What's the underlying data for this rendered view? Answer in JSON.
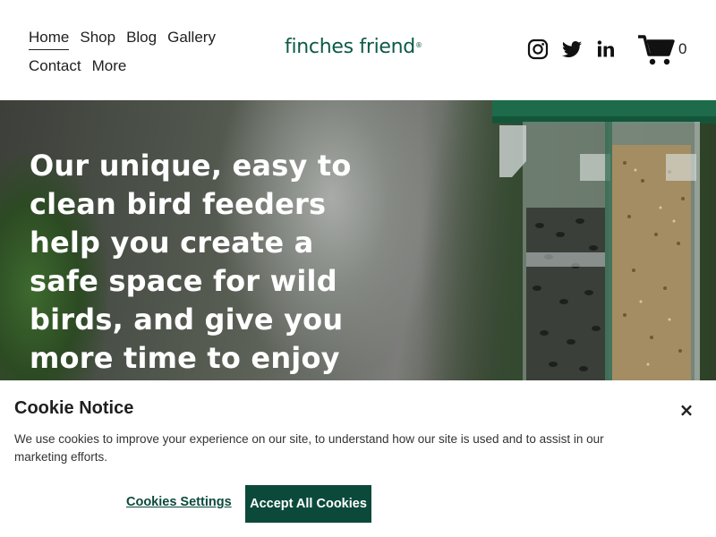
{
  "nav": {
    "items": [
      {
        "label": "Home",
        "active": true
      },
      {
        "label": "Shop"
      },
      {
        "label": "Blog"
      },
      {
        "label": "Gallery"
      },
      {
        "label": "Contact"
      },
      {
        "label": "More"
      }
    ]
  },
  "brand": {
    "name": "finches friend",
    "mark": "®",
    "color": "#0b5a46"
  },
  "header_icons": [
    "instagram-icon",
    "twitter-icon",
    "linkedin-icon",
    "cart-icon"
  ],
  "cart": {
    "count": "0"
  },
  "hero": {
    "text": "Our unique, easy to clean bird feeders help you create a safe space for wild birds, and give you more time to enjoy"
  },
  "cookie": {
    "title": "Cookie Notice",
    "close_glyph": "×",
    "body": "We use cookies to improve your experience on our site, to understand how our site is used and to assist in our marketing efforts.",
    "settings_label": "Cookies Settings",
    "accept_label": "Accept All Cookies",
    "accent_color": "#0b4a3b"
  }
}
